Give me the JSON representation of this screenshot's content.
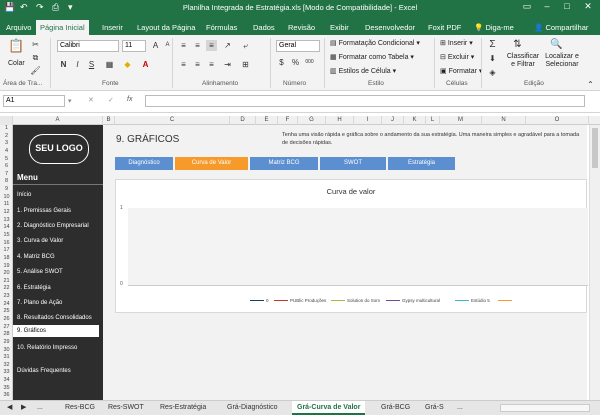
{
  "titlebar": {
    "title": "Planilha Integrada de Estratégia.xls [Modo de Compatibilidade] - Excel"
  },
  "ribbon_tabs": [
    "Arquivo",
    "Página Inicial",
    "Inserir",
    "Layout da Página",
    "Fórmulas",
    "Dados",
    "Revisão",
    "Exibir",
    "Desenvolvedor",
    "Foxit PDF"
  ],
  "tell_me": "Diga-me",
  "share": "Compartilhar",
  "ribbon": {
    "paste": "Colar",
    "clipboard": "Área de Tra...",
    "font_name": "Calibri",
    "font_size": "11",
    "font_group": "Fonte",
    "align_group": "Alinhamento",
    "number_format": "Geral",
    "number_group": "Número",
    "cond_format": "Formatação Condicional",
    "format_table": "Formatar como Tabela",
    "cell_styles": "Estilos de Célula",
    "styles_group": "Estilo",
    "insert": "Inserir",
    "delete": "Excluir",
    "format": "Formatar",
    "cells_group": "Células",
    "sort": "Classificar e Filtrar",
    "find": "Localizar e Selecionar",
    "edit_group": "Edição",
    "font_bold": "N",
    "font_italic": "I",
    "font_underline": "S",
    "font_grow": "A",
    "font_shrink": "A",
    "currency": "$",
    "percent": "%",
    "thousands": "000"
  },
  "formula_bar": {
    "namebox": "A1",
    "fx": "fx",
    "value": ""
  },
  "columns": [
    "A",
    "B",
    "C",
    "D",
    "E",
    "F",
    "G",
    "H",
    "I",
    "J",
    "K",
    "L",
    "M",
    "N",
    "O"
  ],
  "rows": [
    "1",
    "2",
    "3",
    "4",
    "5",
    "6",
    "7",
    "8",
    "9",
    "10",
    "11",
    "12",
    "13",
    "14",
    "15",
    "16",
    "17",
    "18",
    "19",
    "20",
    "21",
    "22",
    "23",
    "24",
    "25",
    "26",
    "27",
    "28",
    "29",
    "30",
    "31",
    "32",
    "33",
    "34",
    "35",
    "36"
  ],
  "sidebar": {
    "logo": "SEU LOGO",
    "menu": "Menu",
    "items": [
      "Início",
      "1. Premissas Gerais",
      "2. Diagnóstico Empresarial",
      "3. Curva de Valor",
      "4. Matriz BCG",
      "5. Análise SWOT",
      "6. Estratégia",
      "7. Plano de Ação",
      "8. Resultados Consolidados",
      "9. Gráficos",
      "10. Relatório Impresso",
      "Dúvidas Frequentes"
    ]
  },
  "page": {
    "title": "9. GRÁFICOS",
    "desc": "Tenha uma visão rápida e gráfica sobre o andamento da sua estratégia. Uma maneira simples e agradável para a tomada de decisões rápidas."
  },
  "nav": [
    "Diagnóstico",
    "Curva de Valor",
    "Matriz BCG",
    "SWOT",
    "Estratégia"
  ],
  "chart": {
    "title": "Curva de valor",
    "ytick_top": "1",
    "ytick_bottom": "0",
    "legend": [
      "0",
      "PUBlic Produções",
      "Solution do Som",
      "Gypsy multicultural",
      "Estúdio 5",
      ""
    ]
  },
  "chart_data": {
    "type": "line",
    "title": "Curva de valor",
    "ylim": [
      0,
      1
    ],
    "series": [
      {
        "name": "0",
        "values": []
      },
      {
        "name": "PUBlic Produções",
        "values": []
      },
      {
        "name": "Solution do Som",
        "values": []
      },
      {
        "name": "Gypsy multicultural",
        "values": []
      },
      {
        "name": "Estúdio 5",
        "values": []
      }
    ]
  },
  "sheet_tabs": [
    "...",
    "Res-BCG",
    "Res-SWOT",
    "Res-Estratégia",
    "Grá-Diagnóstico",
    "Grá-Curva de Valor",
    "Grá-BCG",
    "Grá-S",
    "..."
  ],
  "colors": {
    "excel_green": "#217346",
    "nav_blue": "#5b8fcf",
    "nav_active": "#f59a2b",
    "sidebar": "#2d2d2d"
  }
}
